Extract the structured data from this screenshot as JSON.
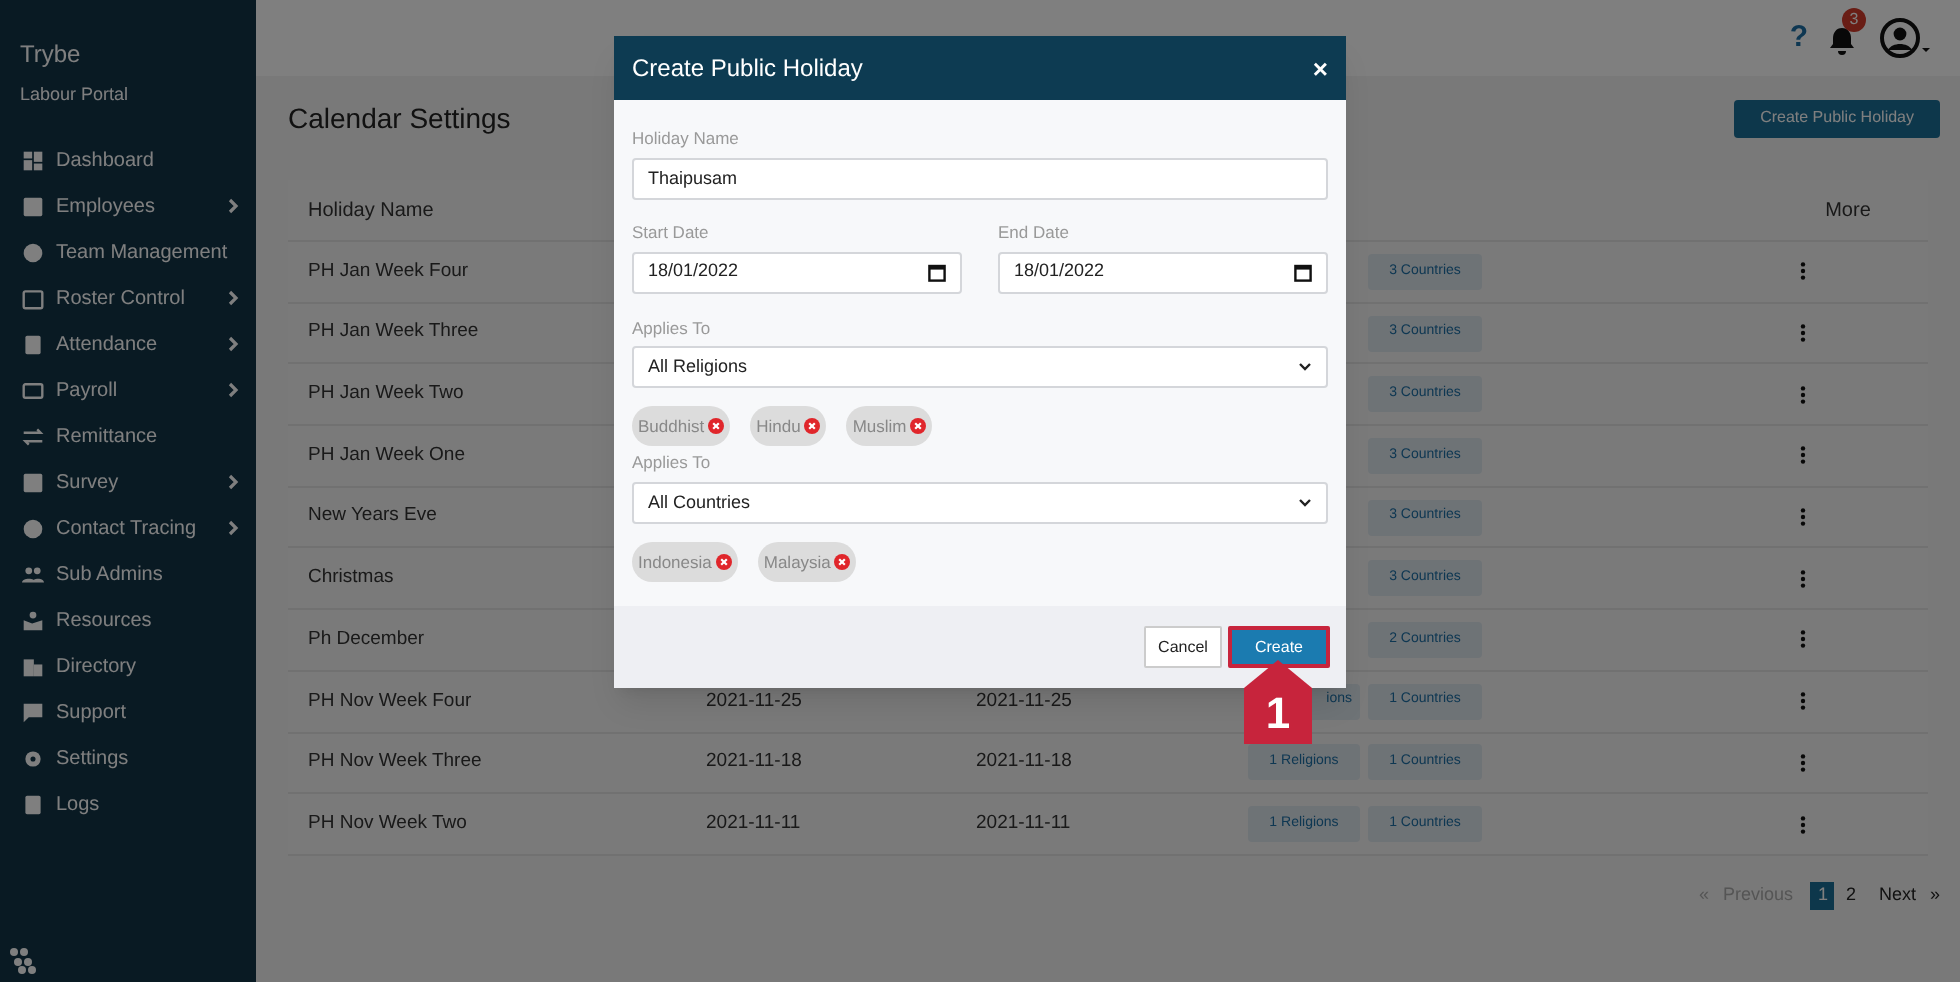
{
  "sidebar": {
    "brand": "Trybe",
    "subtitle": "Labour Portal",
    "items": [
      {
        "label": "Dashboard",
        "expandable": false
      },
      {
        "label": "Employees",
        "expandable": true
      },
      {
        "label": "Team Management",
        "expandable": false
      },
      {
        "label": "Roster Control",
        "expandable": true
      },
      {
        "label": "Attendance",
        "expandable": true
      },
      {
        "label": "Payroll",
        "expandable": true
      },
      {
        "label": "Remittance",
        "expandable": false
      },
      {
        "label": "Survey",
        "expandable": true
      },
      {
        "label": "Contact Tracing",
        "expandable": true
      },
      {
        "label": "Sub Admins",
        "expandable": false
      },
      {
        "label": "Resources",
        "expandable": false
      },
      {
        "label": "Directory",
        "expandable": false
      },
      {
        "label": "Support",
        "expandable": false
      },
      {
        "label": "Settings",
        "expandable": false
      },
      {
        "label": "Logs",
        "expandable": false
      }
    ]
  },
  "topbar": {
    "help": "?",
    "notifications": "3"
  },
  "page": {
    "title": "Calendar Settings",
    "action": "Create Public Holiday"
  },
  "table": {
    "columns": {
      "name": "Holiday Name",
      "more": "More"
    },
    "rows": [
      {
        "name": "PH Jan Week Four",
        "countries": "3 Countries"
      },
      {
        "name": "PH Jan Week Three",
        "countries": "3 Countries"
      },
      {
        "name": "PH Jan Week Two",
        "countries": "3 Countries"
      },
      {
        "name": "PH Jan Week One",
        "countries": "3 Countries"
      },
      {
        "name": "New Years Eve",
        "countries": "3 Countries"
      },
      {
        "name": "Christmas",
        "countries": "3 Countries"
      },
      {
        "name": "Ph December",
        "countries": "2 Countries"
      },
      {
        "name": "PH Nov Week Four",
        "start": "2021-11-25",
        "end": "2021-11-25",
        "religions": "ions",
        "countries": "1 Countries"
      },
      {
        "name": "PH Nov Week Three",
        "start": "2021-11-18",
        "end": "2021-11-18",
        "religions": "1 Religions",
        "countries": "1 Countries"
      },
      {
        "name": "PH Nov Week Two",
        "start": "2021-11-11",
        "end": "2021-11-11",
        "religions": "1 Religions",
        "countries": "1 Countries"
      }
    ]
  },
  "pagination": {
    "previous_arrow": "«",
    "previous": "Previous",
    "pages": [
      {
        "label": "1",
        "selected": true
      },
      {
        "label": "2",
        "selected": false
      }
    ],
    "next": "Next",
    "next_arrow": "»"
  },
  "modal": {
    "title": "Create Public Holiday",
    "close": "×",
    "holiday_name": {
      "label": "Holiday Name",
      "value": "Thaipusam"
    },
    "start_date": {
      "label": "Start Date",
      "value": "18/01/2022"
    },
    "end_date": {
      "label": "End Date",
      "value": "18/01/2022"
    },
    "religions": {
      "label": "Applies To",
      "value": "All Religions",
      "chips": [
        "Buddhist",
        "Hindu",
        "Muslim"
      ]
    },
    "countries": {
      "label": "Applies To",
      "value": "All Countries",
      "chips": [
        "Indonesia",
        "Malaysia"
      ]
    },
    "buttons": [
      {
        "label": "Cancel",
        "kind": "secondary"
      },
      {
        "label": "Create",
        "kind": "primary"
      }
    ]
  },
  "callout": {
    "label": "1"
  }
}
